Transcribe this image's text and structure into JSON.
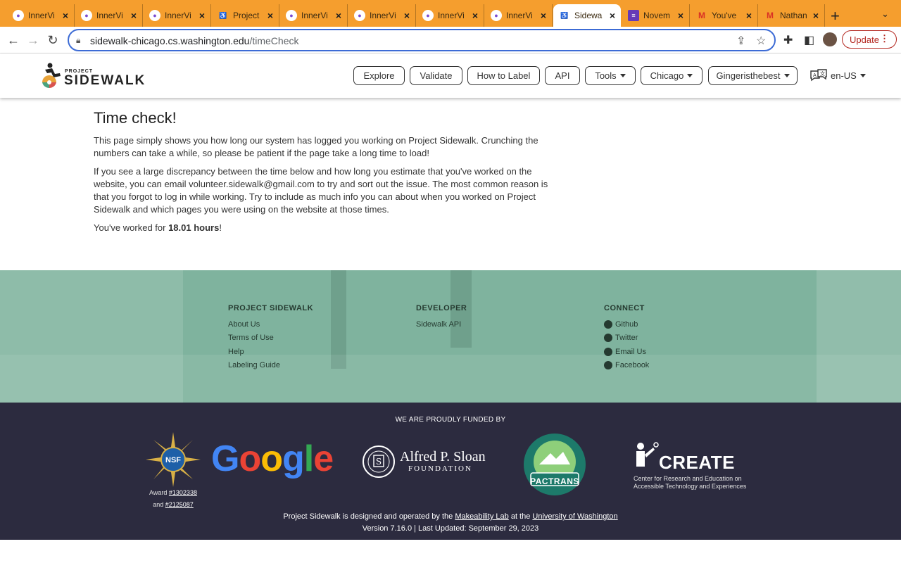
{
  "browser": {
    "tabs": [
      {
        "title": "InnerVi",
        "favicon": "innervision-icon"
      },
      {
        "title": "InnerVi",
        "favicon": "innervision-icon"
      },
      {
        "title": "InnerVi",
        "favicon": "innervision-icon"
      },
      {
        "title": "Project",
        "favicon": "sidewalk-icon"
      },
      {
        "title": "InnerVi",
        "favicon": "innervision-icon"
      },
      {
        "title": "InnerVi",
        "favicon": "innervision-icon"
      },
      {
        "title": "InnerVi",
        "favicon": "innervision-icon"
      },
      {
        "title": "InnerVi",
        "favicon": "innervision-icon"
      },
      {
        "title": "Sidewa",
        "favicon": "sidewalk-icon",
        "active": true
      },
      {
        "title": "Novem",
        "favicon": "forms-icon"
      },
      {
        "title": "You've",
        "favicon": "gmail-icon"
      },
      {
        "title": "Nathan",
        "favicon": "gmail-icon"
      }
    ],
    "url_host": "sidewalk-chicago.cs.washington.edu",
    "url_path": "/timeCheck",
    "update_label": "Update",
    "accent": "#f59e2e"
  },
  "header": {
    "logo_small": "PROJECT",
    "logo_big": "SIDEWALK",
    "nav": {
      "explore": "Explore",
      "validate": "Validate",
      "how_to_label": "How to Label",
      "api": "API",
      "tools": "Tools",
      "city": "Chicago",
      "user": "Gingeristhebest"
    },
    "lang": "en-US"
  },
  "main": {
    "title": "Time check!",
    "para1": "This page simply shows you how long our system has logged you working on Project Sidewalk. Crunching the numbers can take a while, so please be patient if the page take a long time to load!",
    "para2": "If you see a large discrepancy between the time below and how long you estimate that you've worked on the website, you can email volunteer.sidewalk@gmail.com to try and sort out the issue. The most common reason is that you forgot to log in while working. Try to include as much info you can about when you worked on Project Sidewalk and which pages you were using on the website at those times.",
    "worked_prefix": "You've worked for ",
    "worked_hours": "18.01 hours",
    "worked_suffix": "!"
  },
  "footer": {
    "col1": {
      "heading": "PROJECT SIDEWALK",
      "links": [
        "About Us",
        "Terms of Use",
        "Help",
        "Labeling Guide"
      ]
    },
    "col2": {
      "heading": "DEVELOPER",
      "links": [
        "Sidewalk API"
      ]
    },
    "col3": {
      "heading": "CONNECT",
      "links": [
        "Github",
        "Twitter",
        "Email Us",
        "Facebook"
      ]
    },
    "funded_by": "WE ARE PROUDLY FUNDED BY",
    "nsf_award_prefix": "Award ",
    "nsf_award1": "#1302338",
    "nsf_award_and": "and ",
    "nsf_award2": "#2125087",
    "google": "Google",
    "sloan_line1": "Alfred P. Sloan",
    "sloan_line2": "FOUNDATION",
    "pactrans": "PACTRANS",
    "create_title": "CREATE",
    "create_sub1": "Center for Research and Education on",
    "create_sub2": "Accessible Technology and Experiences",
    "credit_prefix": "Project Sidewalk is designed and operated by the ",
    "credit_lab": "Makeability Lab",
    "credit_mid": " at the ",
    "credit_uni": "University of Washington",
    "version": "Version 7.16.0 | Last Updated: September 29, 2023",
    "colors": {
      "green": "#7fb39e",
      "navy": "#2c2b3f"
    }
  }
}
